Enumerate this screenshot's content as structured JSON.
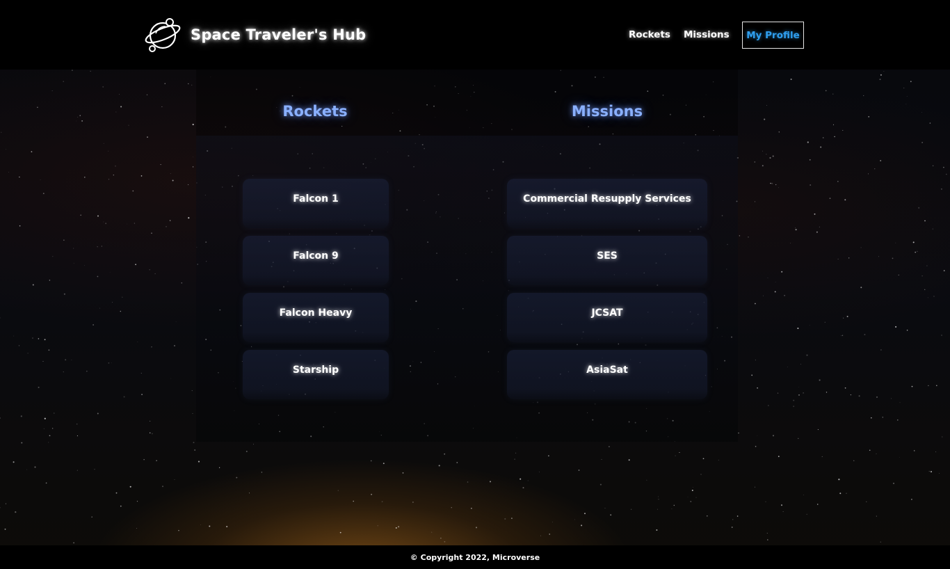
{
  "header": {
    "title": "Space Traveler's Hub",
    "nav": [
      {
        "label": "Rockets"
      },
      {
        "label": "Missions"
      },
      {
        "label": "My Profile",
        "active": true
      }
    ]
  },
  "profile": {
    "rockets": {
      "heading": "Rockets",
      "items": [
        "Falcon 1",
        "Falcon 9",
        "Falcon Heavy",
        "Starship"
      ]
    },
    "missions": {
      "heading": "Missions",
      "items": [
        "Commercial Resupply Services",
        "SES",
        "JCSAT",
        "AsiaSat"
      ]
    }
  },
  "footer": {
    "text": "© Copyright 2022, Microverse"
  },
  "colors": {
    "accent": "#8ab0ff",
    "active_nav": "#2f9ff0",
    "header_bg": "#000000"
  }
}
